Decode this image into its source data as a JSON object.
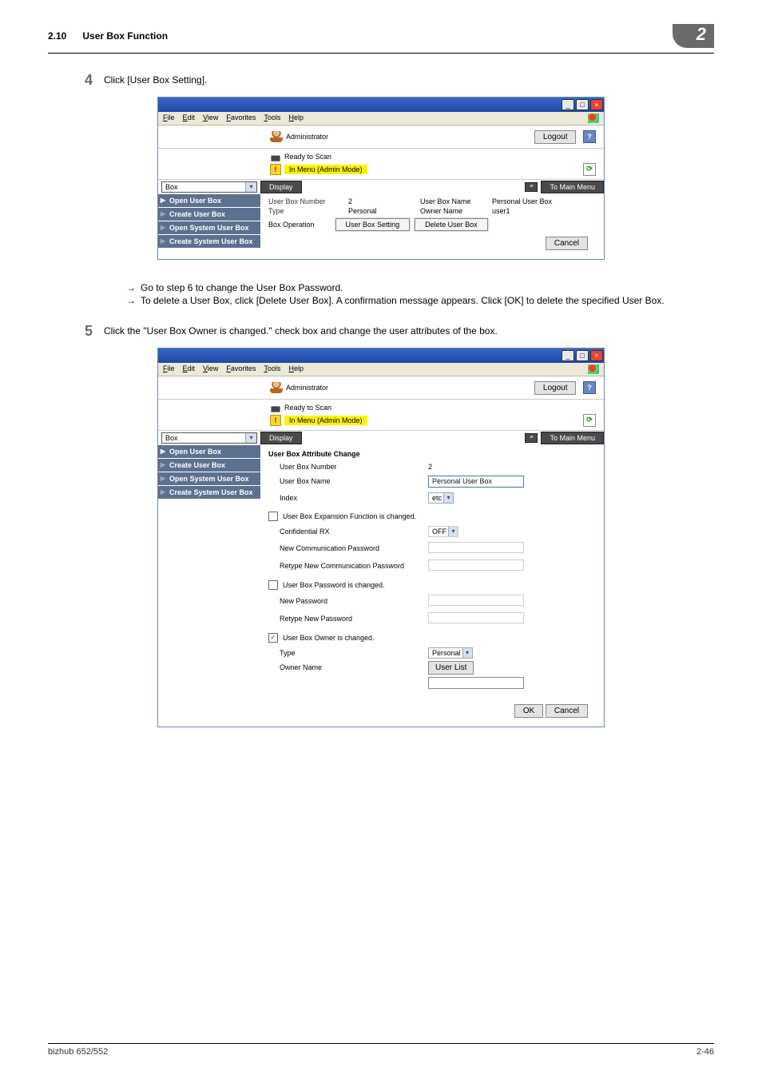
{
  "header": {
    "section": "2.10",
    "title": "User Box Function",
    "chapter": "2"
  },
  "step4": {
    "num": "4",
    "text": "Click [User Box Setting].",
    "sub1": "Go to step 6 to change the User Box Password.",
    "sub2": "To delete a User Box, click [Delete User Box]. A confirmation message appears. Click [OK] to delete the specified User Box."
  },
  "step5": {
    "num": "5",
    "text": "Click the \"User Box Owner is changed.\" check box and change the user attributes of the box."
  },
  "menu": {
    "file": "File",
    "edit": "Edit",
    "view": "View",
    "favorites": "Favorites",
    "tools": "Tools",
    "help": "Help"
  },
  "common": {
    "administrator": "Administrator",
    "logout": "Logout",
    "ready": "Ready to Scan",
    "in_menu": "In Menu (Admin Mode)",
    "box": "Box",
    "display": "Display",
    "to_main": "To Main Menu",
    "nav": {
      "open": "Open User Box",
      "create": "Create User Box",
      "open_sys": "Open System User Box",
      "create_sys": "Create System User Box"
    },
    "cancel": "Cancel",
    "ok": "OK"
  },
  "win1": {
    "ubn_label": "User Box Number",
    "ubn_value": "2",
    "ubname_label": "User Box Name",
    "ubname_value": "Personal User Box",
    "type_label": "Type",
    "type_value": "Personal",
    "owner_label": "Owner Name",
    "owner_value": "user1",
    "box_op": "Box Operation",
    "btn_setting": "User Box Setting",
    "btn_delete": "Delete User Box"
  },
  "win2": {
    "title": "User Box Attribute Change",
    "ubn": "User Box Number",
    "ubn_v": "2",
    "ubname": "User Box Name",
    "ubname_v": "Personal User Box",
    "index": "Index",
    "index_v": "etc",
    "chk1": "User Box Expansion Function is changed.",
    "conf_rx": "Confidential RX",
    "conf_rx_v": "OFF",
    "new_comm": "New Communication Password",
    "retype_comm": "Retype New Communication Password",
    "chk2": "User Box Password is changed.",
    "new_pwd": "New Password",
    "retype_pwd": "Retype New Password",
    "chk3": "User Box Owner is changed.",
    "type": "Type",
    "type_v": "Personal",
    "owner": "Owner Name",
    "userlist": "User List"
  },
  "footer": {
    "left": "bizhub 652/552",
    "right": "2-46"
  }
}
